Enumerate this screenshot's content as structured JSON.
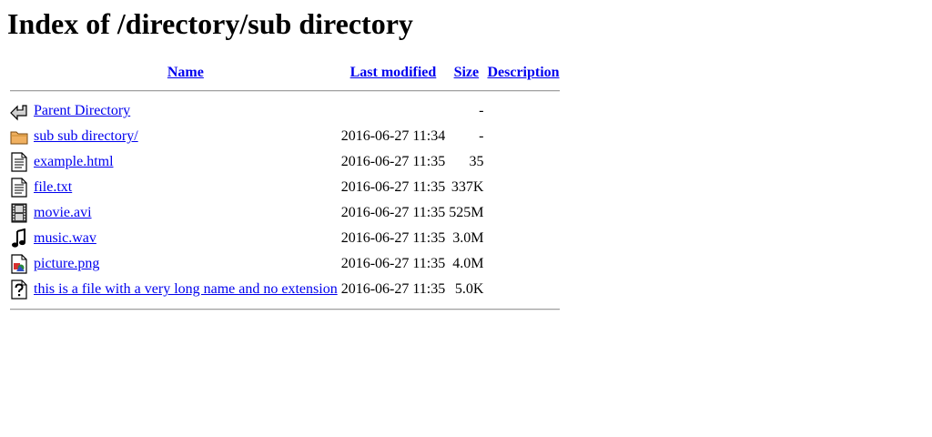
{
  "page": {
    "title": "Index of /directory/sub directory"
  },
  "columns": {
    "name": "Name",
    "last_modified": "Last modified",
    "size": "Size",
    "description": "Description"
  },
  "rows": [
    {
      "icon": "back-icon",
      "name": "Parent Directory",
      "modified": "",
      "size": "-",
      "description": ""
    },
    {
      "icon": "folder-icon",
      "name": "sub sub directory/",
      "modified": "2016-06-27 11:34",
      "size": "-",
      "description": ""
    },
    {
      "icon": "text-file-icon",
      "name": "example.html",
      "modified": "2016-06-27 11:35",
      "size": "35",
      "description": ""
    },
    {
      "icon": "text-file-icon",
      "name": "file.txt",
      "modified": "2016-06-27 11:35",
      "size": "337K",
      "description": ""
    },
    {
      "icon": "movie-file-icon",
      "name": "movie.avi",
      "modified": "2016-06-27 11:35",
      "size": "525M",
      "description": ""
    },
    {
      "icon": "sound-file-icon",
      "name": "music.wav",
      "modified": "2016-06-27 11:35",
      "size": "3.0M",
      "description": ""
    },
    {
      "icon": "image-file-icon",
      "name": "picture.png",
      "modified": "2016-06-27 11:35",
      "size": "4.0M",
      "description": ""
    },
    {
      "icon": "unknown-file-icon",
      "name": "this is a file with a very long name and no extension",
      "modified": "2016-06-27 11:35",
      "size": "5.0K",
      "description": ""
    }
  ],
  "colors": {
    "link": "#0000ee",
    "folder": "#f0b060"
  }
}
